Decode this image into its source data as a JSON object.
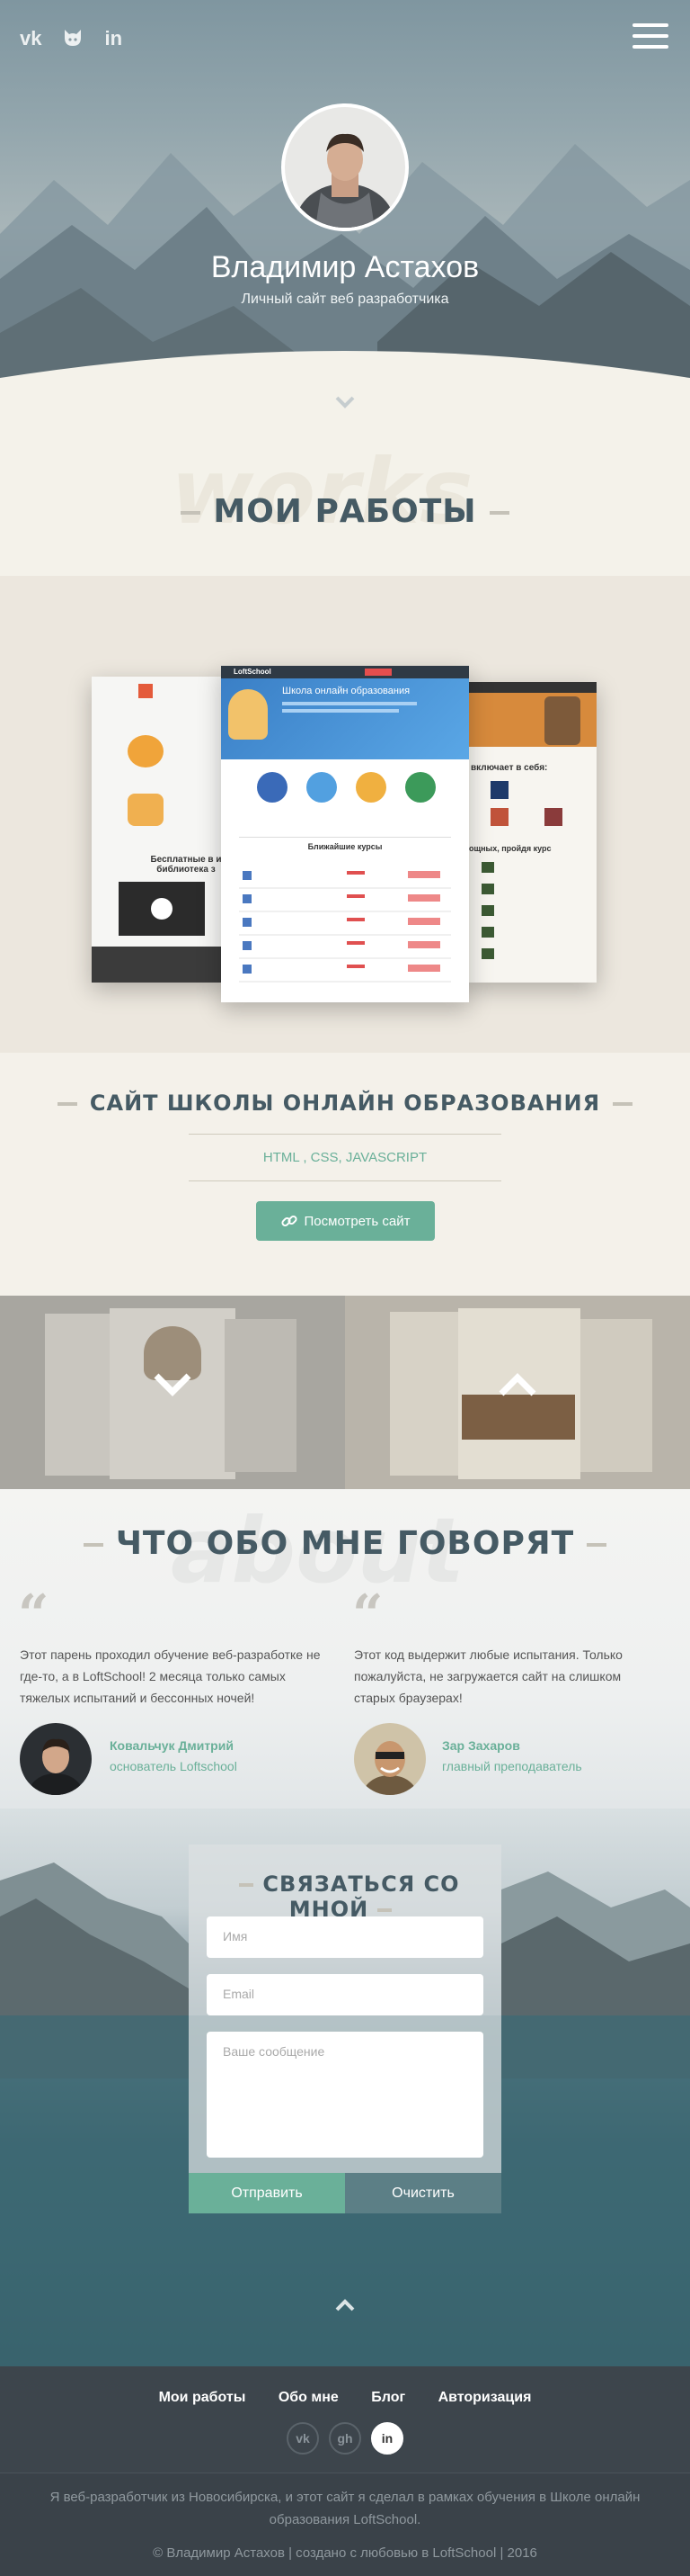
{
  "header": {
    "social": [
      "vk",
      "github",
      "in"
    ],
    "name": "Владимир Астахов",
    "subtitle": "Личный сайт веб разработчика"
  },
  "works": {
    "watermark": "works",
    "title": "МОИ РАБОТЫ",
    "project_title": "САЙТ ШКОЛЫ ОНЛАЙН ОБРАЗОВАНИЯ",
    "tags": "HTML , CSS, JAVASCRIPT",
    "view_button": "Посмотреть сайт"
  },
  "screenshot": {
    "topbar_badge": "LoftSchool",
    "hero_text": "Школа онлайн образования",
    "courses_title": "Ближайшие курсы",
    "left_text": "Бесплатные в и библиотека з",
    "right_text": "включает в себя:",
    "right_text2": "ощных, пройдя курс"
  },
  "reviews": {
    "watermark": "about",
    "title": "ЧТО ОБО МНЕ ГОВОРЯТ",
    "items": [
      {
        "text": "Этот парень проходил обучение веб-разработке не где-то, а в LoftSchool! 2 месяца только самых тяжелых испытаний и бессонных ночей!",
        "name": "Ковальчук Дмитрий",
        "role": "основатель Loftschool"
      },
      {
        "text": "Этот код выдержит любые испытания. Только пожалуйста, не загружается сайт на слишком старых браузерах!",
        "name": "Зар Захаров",
        "role": "главный преподаватель"
      }
    ]
  },
  "contact": {
    "title": "СВЯЗАТЬСЯ СО МНОЙ",
    "name_placeholder": "Имя",
    "email_placeholder": "Email",
    "message_placeholder": "Ваше сообщение",
    "send": "Отправить",
    "clear": "Очистить"
  },
  "footer": {
    "nav": [
      "Мои работы",
      "Обо мне",
      "Блог",
      "Авторизация"
    ],
    "social": [
      "vk",
      "gh",
      "in"
    ],
    "about": "Я веб-разработчик из Новосибирска, и этот сайт я сделал в рамках обучения в Школе онлайн образования LoftSchool.",
    "copyright": "© Владимир Астахов | создано с любовью в LoftSchool | 2016"
  },
  "colors": {
    "accent": "#6ab099",
    "dark": "#455a64",
    "footer": "#3d454c"
  }
}
